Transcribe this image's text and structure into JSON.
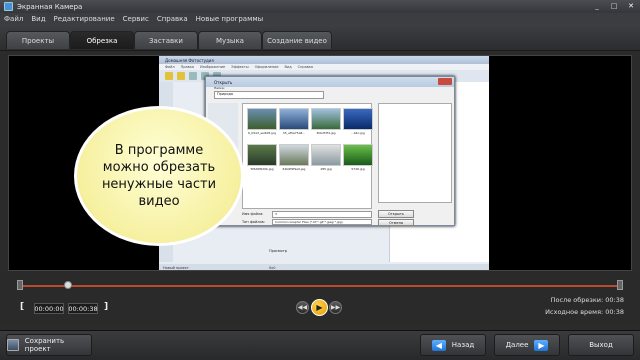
{
  "app": {
    "title": "Экранная Камера"
  },
  "window_controls": [
    "_",
    "□",
    "✕"
  ],
  "menu": [
    "Файл",
    "Вид",
    "Редактирование",
    "Сервис",
    "Справка",
    "Новые программы"
  ],
  "tabs": [
    {
      "label": "Проекты",
      "active": false
    },
    {
      "label": "Обрезка",
      "active": true
    },
    {
      "label": "Заставки",
      "active": false
    },
    {
      "label": "Музыка",
      "active": false
    },
    {
      "label": "Создание видео",
      "active": false
    }
  ],
  "preview": {
    "inner_window_title": "Домашняя Фотостудия",
    "inner_menu": [
      "Файл",
      "Правка",
      "Изображение",
      "Эффекты",
      "Оформление",
      "Вид",
      "Справка"
    ],
    "inner_status": [
      "Новый проект",
      "0x0"
    ],
    "dialog": {
      "title": "Открыть",
      "path_label": "Папка:",
      "path_value": "Природа",
      "files": [
        "6_b5a3_selb05.jpg",
        "35_af5a75a8...",
        "3bb2f3f4.jpg",
        "...6bc.jpg",
        "5f6d6f6d0b.jpg",
        "62b6f9f9a9.jpg",
        "285.jpg",
        "5726.jpg"
      ],
      "filename_label": "Имя файла:",
      "filename_value": "3",
      "filetype_label": "Тип файлов:",
      "filetype_value": "Common Graphic Files (*.bf;*.gif;*.jpeg;*.jpg)",
      "open_button": "Открыть",
      "cancel_button": "Отмена",
      "preview_checkbox": "Просмотр"
    },
    "bubble_text": "В программе можно обрезать ненужные части видео"
  },
  "player": {
    "start_time": "00:00:00",
    "end_time": "00:00:38",
    "bracket_left": "[",
    "bracket_right": "]",
    "after_trim_label": "После обрезки:",
    "after_trim_value": "00:38",
    "original_label": "Исходное время:",
    "original_value": "00:38",
    "progress_fraction": 0.08
  },
  "footer": {
    "save_label": "Сохранить проект",
    "back_label": "Назад",
    "next_label": "Далее",
    "exit_label": "Выход"
  },
  "colors": {
    "accent_track": "#b84a2e",
    "play": "#f0a800",
    "nav_arrow": "#2a84e6"
  }
}
